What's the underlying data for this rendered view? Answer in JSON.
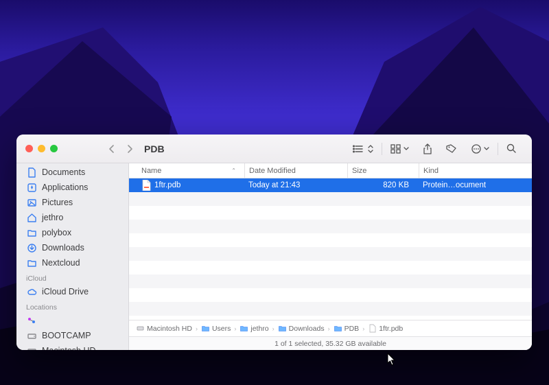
{
  "window": {
    "title": "PDB"
  },
  "columns": {
    "name": "Name",
    "date": "Date Modified",
    "size": "Size",
    "kind": "Kind"
  },
  "file": {
    "name": "1ftr.pdb",
    "date": "Today at 21:43",
    "size": "820 KB",
    "kind": "Protein…ocument"
  },
  "sidebar": {
    "favorites": [
      {
        "label": "Documents",
        "icon": "document"
      },
      {
        "label": "Applications",
        "icon": "app"
      },
      {
        "label": "Pictures",
        "icon": "pictures"
      },
      {
        "label": "jethro",
        "icon": "home"
      },
      {
        "label": "polybox",
        "icon": "folder"
      },
      {
        "label": "Downloads",
        "icon": "download"
      },
      {
        "label": "Nextcloud",
        "icon": "folder"
      }
    ],
    "icloud_label": "iCloud",
    "icloud": [
      {
        "label": "iCloud Drive",
        "icon": "cloud"
      }
    ],
    "locations_label": "Locations",
    "locations": [
      {
        "label": "",
        "icon": "network"
      },
      {
        "label": "BOOTCAMP",
        "icon": "disk"
      },
      {
        "label": "Macintosh HD",
        "icon": "disk"
      }
    ]
  },
  "pathbar": [
    {
      "label": "Macintosh HD",
      "icon": "disk"
    },
    {
      "label": "Users",
      "icon": "folder"
    },
    {
      "label": "jethro",
      "icon": "folder"
    },
    {
      "label": "Downloads",
      "icon": "folder"
    },
    {
      "label": "PDB",
      "icon": "folder"
    },
    {
      "label": "1ftr.pdb",
      "icon": "file"
    }
  ],
  "status": "1 of 1 selected, 35.32 GB available"
}
